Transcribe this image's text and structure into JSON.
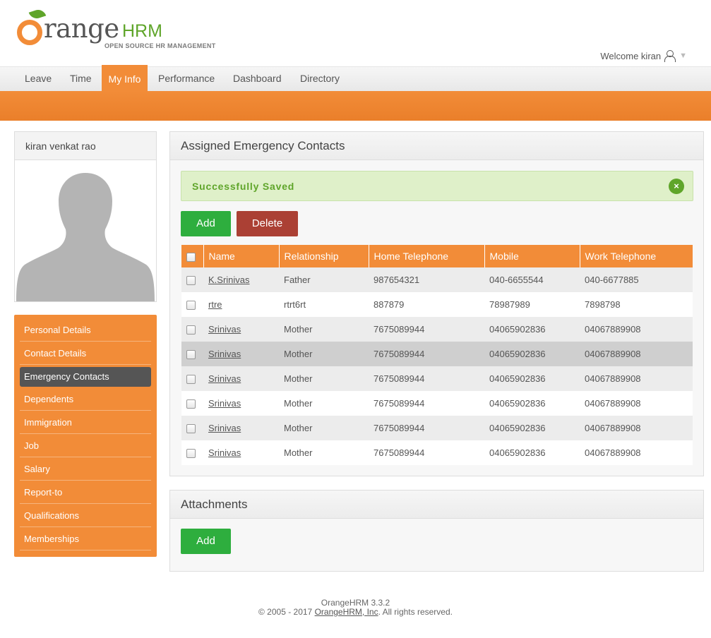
{
  "header": {
    "logo": {
      "word": "range",
      "hrm": "HRM",
      "tagline": "OPEN SOURCE HR MANAGEMENT"
    },
    "welcome": "Welcome kiran"
  },
  "menu": {
    "items": [
      {
        "label": "Leave"
      },
      {
        "label": "Time"
      },
      {
        "label": "My Info",
        "active": true
      },
      {
        "label": "Performance"
      },
      {
        "label": "Dashboard"
      },
      {
        "label": "Directory"
      }
    ]
  },
  "profile": {
    "name": "kiran venkat rao"
  },
  "sidebar": {
    "items": [
      {
        "label": "Personal Details"
      },
      {
        "label": "Contact Details"
      },
      {
        "label": "Emergency Contacts",
        "active": true
      },
      {
        "label": "Dependents"
      },
      {
        "label": "Immigration"
      },
      {
        "label": "Job"
      },
      {
        "label": "Salary"
      },
      {
        "label": "Report-to"
      },
      {
        "label": "Qualifications"
      },
      {
        "label": "Memberships"
      }
    ]
  },
  "contacts": {
    "title": "Assigned Emergency Contacts",
    "message": "Successfully Saved",
    "close_glyph": "×",
    "add_label": "Add",
    "delete_label": "Delete",
    "columns": [
      "Name",
      "Relationship",
      "Home Telephone",
      "Mobile",
      "Work Telephone"
    ],
    "rows": [
      {
        "name": "K.Srinivas",
        "relationship": "Father",
        "home": "987654321",
        "mobile": "040-6655544",
        "work": "040-6677885"
      },
      {
        "name": "rtre",
        "relationship": "rtrt6rt",
        "home": "887879",
        "mobile": "78987989",
        "work": "7898798"
      },
      {
        "name": "Srinivas",
        "relationship": "Mother",
        "home": "7675089944",
        "mobile": "04065902836",
        "work": "04067889908"
      },
      {
        "name": "Srinivas",
        "relationship": "Mother",
        "home": "7675089944",
        "mobile": "04065902836",
        "work": "04067889908"
      },
      {
        "name": "Srinivas",
        "relationship": "Mother",
        "home": "7675089944",
        "mobile": "04065902836",
        "work": "04067889908"
      },
      {
        "name": "Srinivas",
        "relationship": "Mother",
        "home": "7675089944",
        "mobile": "04065902836",
        "work": "04067889908"
      },
      {
        "name": "Srinivas",
        "relationship": "Mother",
        "home": "7675089944",
        "mobile": "04065902836",
        "work": "04067889908"
      },
      {
        "name": "Srinivas",
        "relationship": "Mother",
        "home": "7675089944",
        "mobile": "04065902836",
        "work": "04067889908"
      }
    ]
  },
  "attachments": {
    "title": "Attachments",
    "add_label": "Add"
  },
  "footer": {
    "version": "OrangeHRM 3.3.2",
    "copyright_prefix": "© 2005 - 2017 ",
    "company_link": "OrangeHRM, Inc",
    "copyright_suffix": ". All rights reserved."
  },
  "colors": {
    "brand_orange": "#f28c38",
    "brand_green": "#5fa52a",
    "button_green": "#2eae3e",
    "button_red": "#ab4034"
  }
}
